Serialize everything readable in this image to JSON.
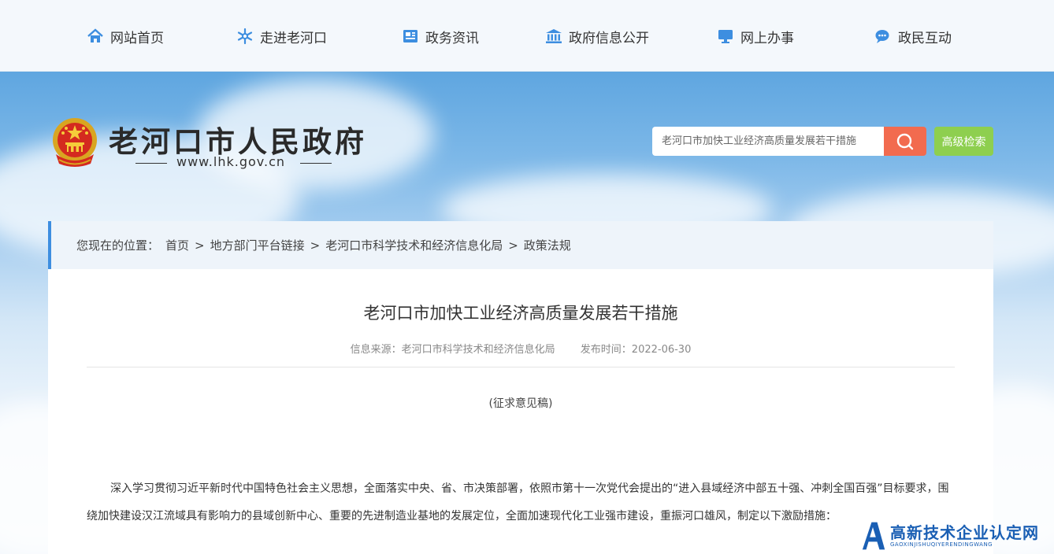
{
  "nav": {
    "items": [
      {
        "label": "网站首页",
        "icon": "home-icon"
      },
      {
        "label": "走进老河口",
        "icon": "snowflake-icon"
      },
      {
        "label": "政务资讯",
        "icon": "news-icon"
      },
      {
        "label": "政府信息公开",
        "icon": "government-building-icon"
      },
      {
        "label": "网上办事",
        "icon": "monitor-icon"
      },
      {
        "label": "政民互动",
        "icon": "chat-icon"
      }
    ]
  },
  "header": {
    "site_title": "老河口市人民政府",
    "site_url": "www.lhk.gov.cn",
    "search_value": "老河口市加快工业经济高质量发展若干措施",
    "advanced_search_label": "高级检索"
  },
  "breadcrumb": {
    "prefix": "您现在的位置：",
    "items": [
      "首页",
      "地方部门平台链接",
      "老河口市科学技术和经济信息化局",
      "政策法规"
    ],
    "separator": ">"
  },
  "article": {
    "title": "老河口市加快工业经济高质量发展若干措施",
    "source": "信息来源：老河口市科学技术和经济信息化局",
    "date": "发布时间：2022-06-30",
    "subtitle": "(征求意见稿)",
    "body": "深入学习贯彻习近平新时代中国特色社会主义思想，全面落实中央、省、市决策部署，依照市第十一次党代会提出的“进入县域经济中部五十强、冲刺全国百强”目标要求，围绕加快建设汉江流域具有影响力的县域创新中心、重要的先进制造业基地的发展定位，全面加速现代化工业强市建设，重振河口雄风，制定以下激励措施："
  },
  "watermark": {
    "main": "高新技术企业认定网",
    "sub": "GAOXINJISHUQIYERENDINGWANG"
  },
  "colors": {
    "accent_blue": "#3d8ee0",
    "search_button": "#f26b4f",
    "advanced_button": "#8ecf4f",
    "nav_icon": "#3d8ee0"
  }
}
